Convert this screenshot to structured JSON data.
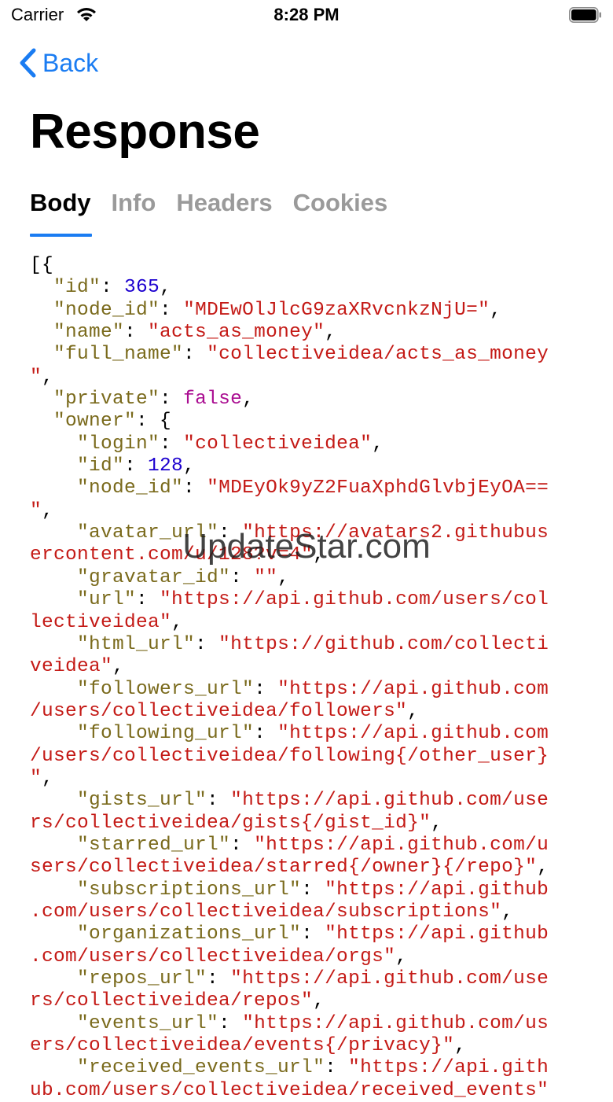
{
  "status_bar": {
    "carrier": "Carrier",
    "time": "8:28 PM"
  },
  "nav": {
    "back_label": "Back",
    "title": "Response"
  },
  "tabs": [
    {
      "label": "Body",
      "active": true
    },
    {
      "label": "Info",
      "active": false
    },
    {
      "label": "Headers",
      "active": false
    },
    {
      "label": "Cookies",
      "active": false
    }
  ],
  "watermark": "UpdateStar.com",
  "colors": {
    "accent": "#1a7cf2",
    "key": "#7a6a1c",
    "string": "#c41a16",
    "number": "#1c00cf",
    "bool": "#aa0d91"
  },
  "body_lines": [
    [
      [
        "p",
        "[{"
      ]
    ],
    [
      [
        "p",
        "  "
      ],
      [
        "k",
        "\"id\""
      ],
      [
        "p",
        ": "
      ],
      [
        "n",
        "365"
      ],
      [
        "p",
        ","
      ]
    ],
    [
      [
        "p",
        "  "
      ],
      [
        "k",
        "\"node_id\""
      ],
      [
        "p",
        ": "
      ],
      [
        "s",
        "\"MDEwOlJlcG9zaXRvcnkzNjU=\""
      ],
      [
        "p",
        ","
      ]
    ],
    [
      [
        "p",
        "  "
      ],
      [
        "k",
        "\"name\""
      ],
      [
        "p",
        ": "
      ],
      [
        "s",
        "\"acts_as_money\""
      ],
      [
        "p",
        ","
      ]
    ],
    [
      [
        "p",
        "  "
      ],
      [
        "k",
        "\"full_name\""
      ],
      [
        "p",
        ": "
      ],
      [
        "s",
        "\"collectiveidea/acts_as_money"
      ]
    ],
    [
      [
        "s",
        "\""
      ],
      [
        "p",
        ","
      ]
    ],
    [
      [
        "p",
        "  "
      ],
      [
        "k",
        "\"private\""
      ],
      [
        "p",
        ": "
      ],
      [
        "b",
        "false"
      ],
      [
        "p",
        ","
      ]
    ],
    [
      [
        "p",
        "  "
      ],
      [
        "k",
        "\"owner\""
      ],
      [
        "p",
        ": {"
      ]
    ],
    [
      [
        "p",
        "    "
      ],
      [
        "k",
        "\"login\""
      ],
      [
        "p",
        ": "
      ],
      [
        "s",
        "\"collectiveidea\""
      ],
      [
        "p",
        ","
      ]
    ],
    [
      [
        "p",
        "    "
      ],
      [
        "k",
        "\"id\""
      ],
      [
        "p",
        ": "
      ],
      [
        "n",
        "128"
      ],
      [
        "p",
        ","
      ]
    ],
    [
      [
        "p",
        "    "
      ],
      [
        "k",
        "\"node_id\""
      ],
      [
        "p",
        ": "
      ],
      [
        "s",
        "\"MDEyOk9yZ2FuaXphdGlvbjEyOA=="
      ]
    ],
    [
      [
        "s",
        "\""
      ],
      [
        "p",
        ","
      ]
    ],
    [
      [
        "p",
        "    "
      ],
      [
        "k",
        "\"avatar_url\""
      ],
      [
        "p",
        ": "
      ],
      [
        "s",
        "\"https://avatars2.githubus"
      ]
    ],
    [
      [
        "s",
        "ercontent.com/u/128?v=4\""
      ],
      [
        "p",
        ","
      ]
    ],
    [
      [
        "p",
        "    "
      ],
      [
        "k",
        "\"gravatar_id\""
      ],
      [
        "p",
        ": "
      ],
      [
        "s",
        "\"\""
      ],
      [
        "p",
        ","
      ]
    ],
    [
      [
        "p",
        "    "
      ],
      [
        "k",
        "\"url\""
      ],
      [
        "p",
        ": "
      ],
      [
        "s",
        "\"https://api.github.com/users/col"
      ]
    ],
    [
      [
        "s",
        "lectiveidea\""
      ],
      [
        "p",
        ","
      ]
    ],
    [
      [
        "p",
        "    "
      ],
      [
        "k",
        "\"html_url\""
      ],
      [
        "p",
        ": "
      ],
      [
        "s",
        "\"https://github.com/collecti"
      ]
    ],
    [
      [
        "s",
        "veidea\""
      ],
      [
        "p",
        ","
      ]
    ],
    [
      [
        "p",
        "    "
      ],
      [
        "k",
        "\"followers_url\""
      ],
      [
        "p",
        ": "
      ],
      [
        "s",
        "\"https://api.github.com"
      ]
    ],
    [
      [
        "s",
        "/users/collectiveidea/followers\""
      ],
      [
        "p",
        ","
      ]
    ],
    [
      [
        "p",
        "    "
      ],
      [
        "k",
        "\"following_url\""
      ],
      [
        "p",
        ": "
      ],
      [
        "s",
        "\"https://api.github.com"
      ]
    ],
    [
      [
        "s",
        "/users/collectiveidea/following{/other_user}"
      ]
    ],
    [
      [
        "s",
        "\""
      ],
      [
        "p",
        ","
      ]
    ],
    [
      [
        "p",
        "    "
      ],
      [
        "k",
        "\"gists_url\""
      ],
      [
        "p",
        ": "
      ],
      [
        "s",
        "\"https://api.github.com/use"
      ]
    ],
    [
      [
        "s",
        "rs/collectiveidea/gists{/gist_id}\""
      ],
      [
        "p",
        ","
      ]
    ],
    [
      [
        "p",
        "    "
      ],
      [
        "k",
        "\"starred_url\""
      ],
      [
        "p",
        ": "
      ],
      [
        "s",
        "\"https://api.github.com/u"
      ]
    ],
    [
      [
        "s",
        "sers/collectiveidea/starred{/owner}{/repo}\""
      ],
      [
        "p",
        ","
      ]
    ],
    [
      [
        "p",
        "    "
      ],
      [
        "k",
        "\"subscriptions_url\""
      ],
      [
        "p",
        ": "
      ],
      [
        "s",
        "\"https://api.github"
      ]
    ],
    [
      [
        "s",
        ".com/users/collectiveidea/subscriptions\""
      ],
      [
        "p",
        ","
      ]
    ],
    [
      [
        "p",
        "    "
      ],
      [
        "k",
        "\"organizations_url\""
      ],
      [
        "p",
        ": "
      ],
      [
        "s",
        "\"https://api.github"
      ]
    ],
    [
      [
        "s",
        ".com/users/collectiveidea/orgs\""
      ],
      [
        "p",
        ","
      ]
    ],
    [
      [
        "p",
        "    "
      ],
      [
        "k",
        "\"repos_url\""
      ],
      [
        "p",
        ": "
      ],
      [
        "s",
        "\"https://api.github.com/use"
      ]
    ],
    [
      [
        "s",
        "rs/collectiveidea/repos\""
      ],
      [
        "p",
        ","
      ]
    ],
    [
      [
        "p",
        "    "
      ],
      [
        "k",
        "\"events_url\""
      ],
      [
        "p",
        ": "
      ],
      [
        "s",
        "\"https://api.github.com/us"
      ]
    ],
    [
      [
        "s",
        "ers/collectiveidea/events{/privacy}\""
      ],
      [
        "p",
        ","
      ]
    ],
    [
      [
        "p",
        "    "
      ],
      [
        "k",
        "\"received_events_url\""
      ],
      [
        "p",
        ": "
      ],
      [
        "s",
        "\"https://api.gith"
      ]
    ],
    [
      [
        "s",
        "ub.com/users/collectiveidea/received_events\""
      ]
    ]
  ]
}
